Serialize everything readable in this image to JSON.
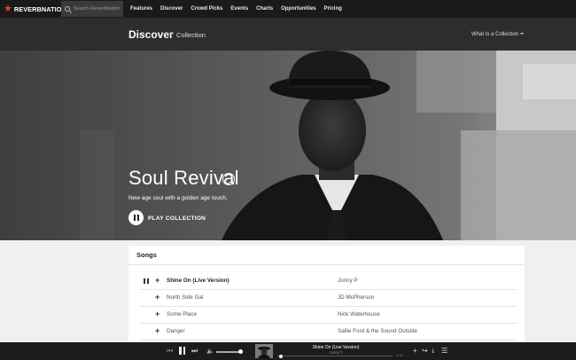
{
  "brand": {
    "name": "REVERBNATION",
    "accent": "#e43e2b"
  },
  "search": {
    "placeholder": "Search ReverbNation"
  },
  "nav": {
    "items": [
      "Features",
      "Discover",
      "Crowd Picks",
      "Events",
      "Charts",
      "Opportunities",
      "Pricing"
    ]
  },
  "header": {
    "title": "Discover",
    "crumb": "Collection",
    "menu_label": "What Is a Collection"
  },
  "hero": {
    "title": "Soul Revival",
    "description": "New age soul with a golden age touch.",
    "play_label": "PLAY COLLECTION"
  },
  "songs": {
    "heading": "Songs",
    "rows": [
      {
        "title": "Shine On (Live Version)",
        "artist": "Jonny P",
        "playing": true
      },
      {
        "title": "North Side Gal",
        "artist": "JD McPherson",
        "playing": false
      },
      {
        "title": "Some Place",
        "artist": "Nick Waterhouse",
        "playing": false
      },
      {
        "title": "Danger",
        "artist": "Sallie Ford & the Sound Outside",
        "playing": false
      }
    ]
  },
  "player": {
    "track_title": "Shine On (Live Version)",
    "track_artist": "Jonny P",
    "time": "0:16",
    "progress": 0.03,
    "volume": 0.9
  }
}
